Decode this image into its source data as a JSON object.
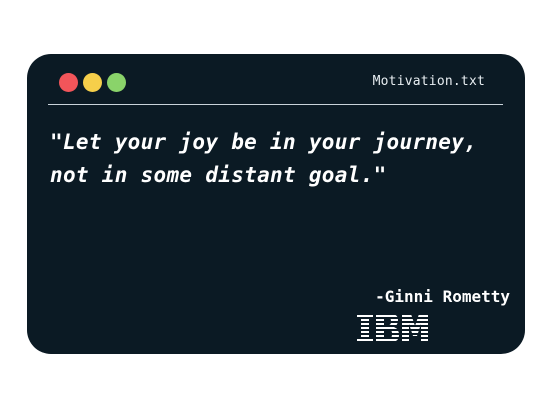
{
  "window": {
    "title": "Motivation.txt",
    "controls": [
      {
        "name": "close",
        "color": "#f2555a"
      },
      {
        "name": "minimize",
        "color": "#f6cf4a"
      },
      {
        "name": "maximize",
        "color": "#8ad36a"
      }
    ],
    "background": "#0b1a24"
  },
  "quote": {
    "text": "\"Let your joy be in your journey, not in some distant goal.\"",
    "author": "-Ginni Rometty",
    "logo_text": "IBM"
  }
}
